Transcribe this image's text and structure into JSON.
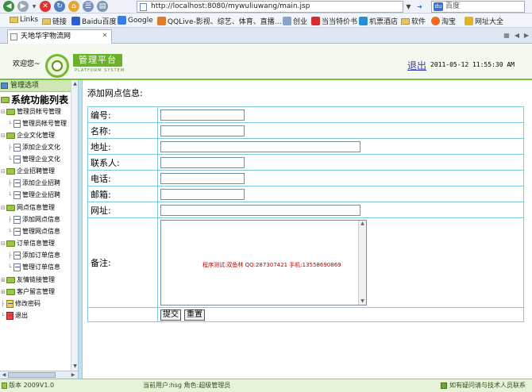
{
  "browser": {
    "url": "http://localhost:8080/mywuliuwang/main.jsp",
    "search_placeholder": "百度",
    "search_engine_icon": "baidu-icon",
    "bookmarks": [
      {
        "label": "Links",
        "icon": "folder-icon"
      },
      {
        "label": "链接",
        "icon": "folder-icon"
      },
      {
        "label": "Baidu百度",
        "icon": "baidu-favicon"
      },
      {
        "label": "Google",
        "icon": "google-favicon"
      },
      {
        "label": "QQLive-影视、综艺、体育、直播…",
        "icon": "qqlive-favicon"
      },
      {
        "label": "创业",
        "icon": "page-favicon"
      },
      {
        "label": "当当特价书",
        "icon": "dangdang-favicon"
      },
      {
        "label": "机票酒店",
        "icon": "flight-favicon"
      },
      {
        "label": "软件",
        "icon": "folder-icon"
      },
      {
        "label": "淘宝",
        "icon": "taobao-favicon"
      },
      {
        "label": "网址大全",
        "icon": "star-favicon"
      }
    ],
    "tab_title": "天地华宇物流网"
  },
  "header": {
    "welcome": "欢迎您~",
    "logo_text": "管理平台",
    "logo_subtext": "PLATFORM SYSTEM",
    "logout_label": "退出",
    "datetime": "2011-05-12 11:55:30 AM"
  },
  "sidebar": {
    "header": "管理选项",
    "root": "系统功能列表",
    "groups": [
      {
        "label": "管理员帐号管理",
        "items": [
          "管理员帐号管理"
        ]
      },
      {
        "label": "企业文化管理",
        "items": [
          "添加企业文化",
          "管理企业文化"
        ]
      },
      {
        "label": "企业招聘管理",
        "items": [
          "添加企业招聘",
          "管理企业招聘"
        ]
      },
      {
        "label": "网点信息管理",
        "items": [
          "添加网点信息",
          "管理网点信息"
        ]
      },
      {
        "label": "订单信息管理",
        "items": [
          "添加订单信息",
          "管理订单信息"
        ]
      },
      {
        "label": "友情链接管理",
        "items": []
      },
      {
        "label": "客户留言管理",
        "items": []
      }
    ],
    "change_password": "修改密码",
    "exit": "退出"
  },
  "main": {
    "form_title": "添加网点信息:",
    "fields": {
      "code": {
        "label": "编号:",
        "value": ""
      },
      "name": {
        "label": "名称:",
        "value": ""
      },
      "address": {
        "label": "地址:",
        "value": ""
      },
      "contact": {
        "label": "联系人:",
        "value": ""
      },
      "phone": {
        "label": "电话:",
        "value": ""
      },
      "postcode": {
        "label": "邮箱:",
        "value": ""
      },
      "website": {
        "label": "网址:",
        "value": ""
      },
      "remark": {
        "label": "备注:",
        "value": ""
      }
    },
    "remark_watermark": "程序测试:双鱼林 QQ:287307421 手机:13558690869",
    "submit_label": "提交",
    "reset_label": "重置"
  },
  "footer": {
    "version": "版本 2009V1.0",
    "current_user": "当前用户:hsg  角色:超级管理员",
    "help": "如有疑问请与技术人员联系"
  }
}
